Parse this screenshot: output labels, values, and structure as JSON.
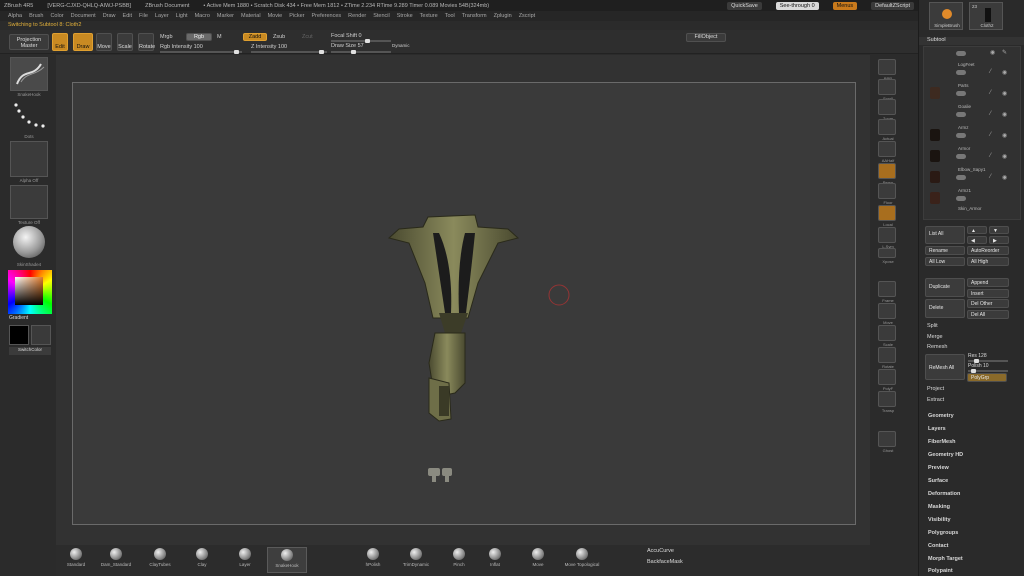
{
  "titlebar": {
    "app": "ZBrush 4R5",
    "build": "[VERG-CJXD-QHLQ-AIWJ-PSBB]",
    "doc": "ZBrush Document",
    "mem": "• Active Mem 1880 • Scratch Disk 434 • Free Mem 1812 • ZTime 2.234 RTime 9.289 Timer 0.089 Movies 54B(324mb)",
    "quicksave": "QuickSave",
    "seethrough": "See-through  0",
    "menus": "Menus",
    "script": "DefaultZScript"
  },
  "menubar": [
    "Alpha",
    "Brush",
    "Color",
    "Document",
    "Draw",
    "Edit",
    "File",
    "Layer",
    "Light",
    "Macro",
    "Marker",
    "Material",
    "Movie",
    "Picker",
    "Preferences",
    "Render",
    "Stencil",
    "Stroke",
    "Texture",
    "Tool",
    "Transform",
    "Zplugin",
    "Zscript"
  ],
  "status": "Switching to Subtool 8: Cloth2",
  "toptool": {
    "projection": "Projection Master",
    "edit": "Edit",
    "draw": "Draw",
    "move": "Move",
    "scale": "Scale",
    "rotate": "Rotate",
    "mrgb": "Mrgb",
    "rgb": "Rgb",
    "m": "M",
    "rgb_intensity": "Rgb Intensity 100",
    "zadd": "Zadd",
    "zsub": "Zsub",
    "zcut": "Zcut",
    "z_intensity": "Z Intensity 100",
    "focal": "Focal Shift 0",
    "drawsize": "Draw Size 57",
    "dynamic": "Dynamic",
    "fill": "FillObject"
  },
  "leftshelf": {
    "brush_label": "SnakeHook",
    "stroke_label": "Dots",
    "alpha_label": "Alpha Off",
    "texture_label": "Texture Off",
    "material_label": "SkinShade4",
    "gradient": "Gradient",
    "switch": "SwitchColor"
  },
  "rightshelf": [
    "BPR",
    "Scroll",
    "Zoom",
    "Actual",
    "AAHalf",
    "Persp",
    "Floor",
    "Local",
    "L.Sym",
    "Xpose",
    "Frame",
    "Move",
    "Scale",
    "Rotate",
    "PolyF",
    "Transp",
    "Ghost",
    "Solo"
  ],
  "rightpanel": {
    "tool1": "SimpleBrush",
    "tool2": "Cloth2",
    "tool2_count": "23",
    "subtool_header": "Subtool",
    "subtools": [
      "LogFeet",
      "Parts",
      "Goalie",
      "Armz",
      "Armor",
      "Elbow_Sapy1",
      "Armz1",
      "Skin_Armor"
    ],
    "list_all": "List All",
    "rename": "Rename",
    "autoreorder": "AutoReorder",
    "all_low": "All Low",
    "all_high": "All High",
    "duplicate": "Duplicate",
    "append": "Append",
    "insert": "Insert",
    "delete": "Delete",
    "del_other": "Del Other",
    "del_all": "Del All",
    "split": "Split",
    "merge": "Merge",
    "remesh": "Remesh",
    "remesh_all": "ReMesh All",
    "res": "Res 128",
    "polish": "Polish 10",
    "polygrp": "PolyGrp",
    "project": "Project",
    "extract": "Extract",
    "menus": [
      "Geometry",
      "Layers",
      "FiberMesh",
      "Geometry HD",
      "Preview",
      "Surface",
      "Deformation",
      "Masking",
      "Visibility",
      "Polygroups",
      "Contact",
      "Morph Target",
      "Polypaint"
    ]
  },
  "bottombar": {
    "brushes": [
      "Standard",
      "Dam_Standard",
      "ClayTubes",
      "Clay",
      "Layer",
      "SnakeHook",
      "hPolish",
      "TrimDynamic",
      "Pinch",
      "Inflat",
      "Move",
      "Move Topological"
    ],
    "right": [
      "AccuCurve",
      "BackfaceMask"
    ]
  },
  "colors": {
    "accent": "#c98a22",
    "panel": "#2a2a2a",
    "canvas": "#3a3a3a"
  }
}
